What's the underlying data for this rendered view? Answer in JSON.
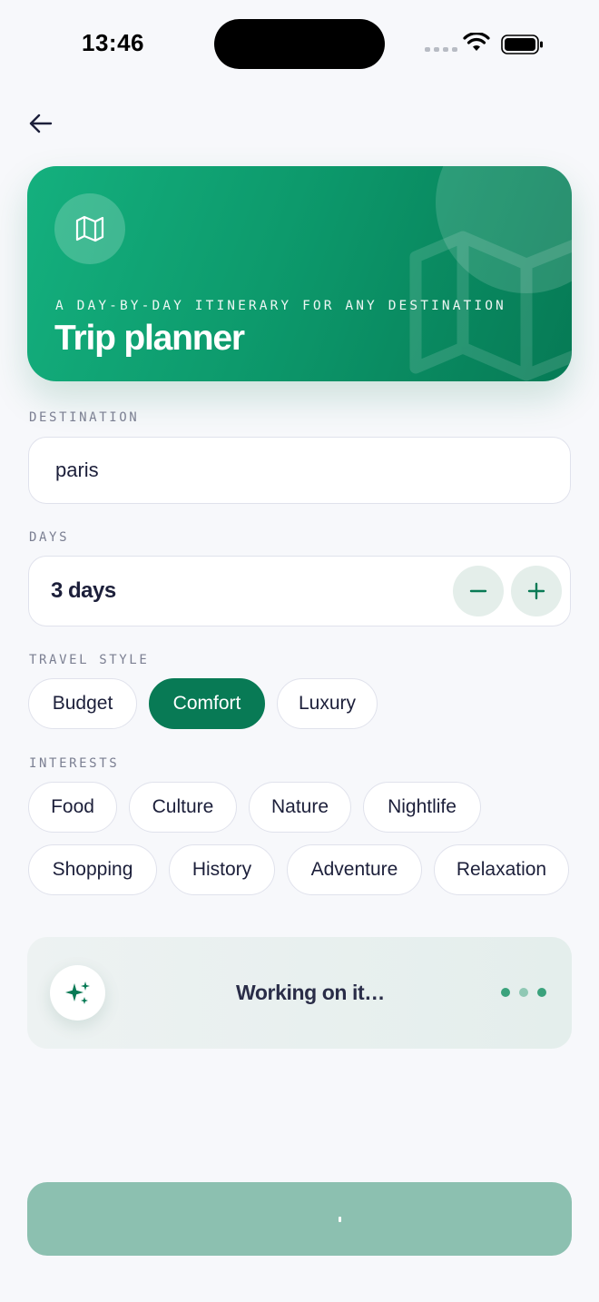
{
  "status_bar": {
    "time": "13:46"
  },
  "hero": {
    "subtitle": "A DAY-BY-DAY ITINERARY FOR ANY DESTINATION",
    "title": "Trip planner",
    "icon": "map-icon"
  },
  "destination": {
    "label": "DESTINATION",
    "value": "paris"
  },
  "days": {
    "label": "DAYS",
    "value": "3 days"
  },
  "travel_style": {
    "label": "TRAVEL STYLE",
    "options": [
      "Budget",
      "Comfort",
      "Luxury"
    ],
    "selected": "Comfort"
  },
  "interests": {
    "label": "INTERESTS",
    "options": [
      "Food",
      "Culture",
      "Nature",
      "Nightlife",
      "Shopping",
      "History",
      "Adventure",
      "Relaxation"
    ]
  },
  "progress": {
    "text": "Working on it…",
    "icon": "sparkles-icon"
  },
  "colors": {
    "accent": "#087a55",
    "hero_start": "#14b07e",
    "hero_end": "#067a55",
    "button_disabled": "#8cc0b0"
  }
}
